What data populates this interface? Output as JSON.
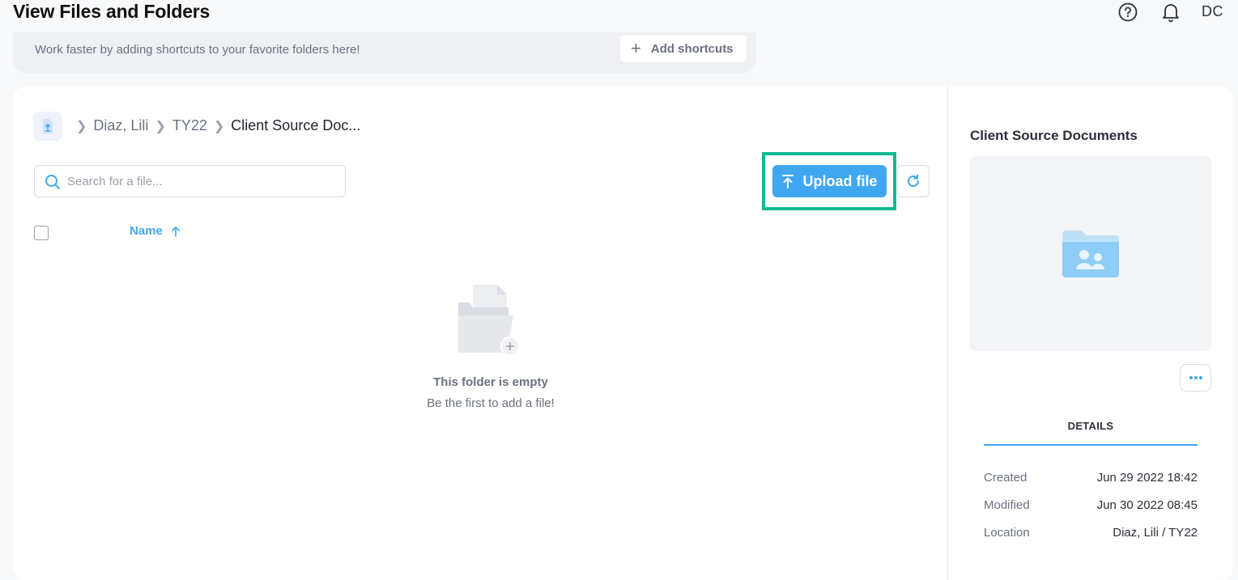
{
  "header": {
    "title": "View Files and Folders",
    "avatar_initials": "DC"
  },
  "shortcuts": {
    "message": "Work faster by adding shortcuts to your favorite folders here!",
    "add_label": "Add shortcuts"
  },
  "breadcrumb": {
    "items": [
      "Diaz, Lili",
      "TY22"
    ],
    "current": "Client Source Doc..."
  },
  "search": {
    "placeholder": "Search for a file...",
    "value": ""
  },
  "toolbar": {
    "upload_label": "Upload file"
  },
  "table": {
    "columns": [
      "Name"
    ],
    "sort": "ascending"
  },
  "empty_state": {
    "title": "This folder is empty",
    "subtitle": "Be the first to add a file!"
  },
  "details_panel": {
    "title": "Client Source Documents",
    "tab_label": "DETAILS",
    "rows": [
      {
        "label": "Created",
        "value": "Jun 29 2022 18:42"
      },
      {
        "label": "Modified",
        "value": "Jun 30 2022 08:45"
      },
      {
        "label": "Location",
        "value": "Diaz, Lili / TY22"
      }
    ]
  },
  "colors": {
    "accent": "#3fa7f0",
    "highlight": "#14b890",
    "folder": "#8ecdf5"
  }
}
